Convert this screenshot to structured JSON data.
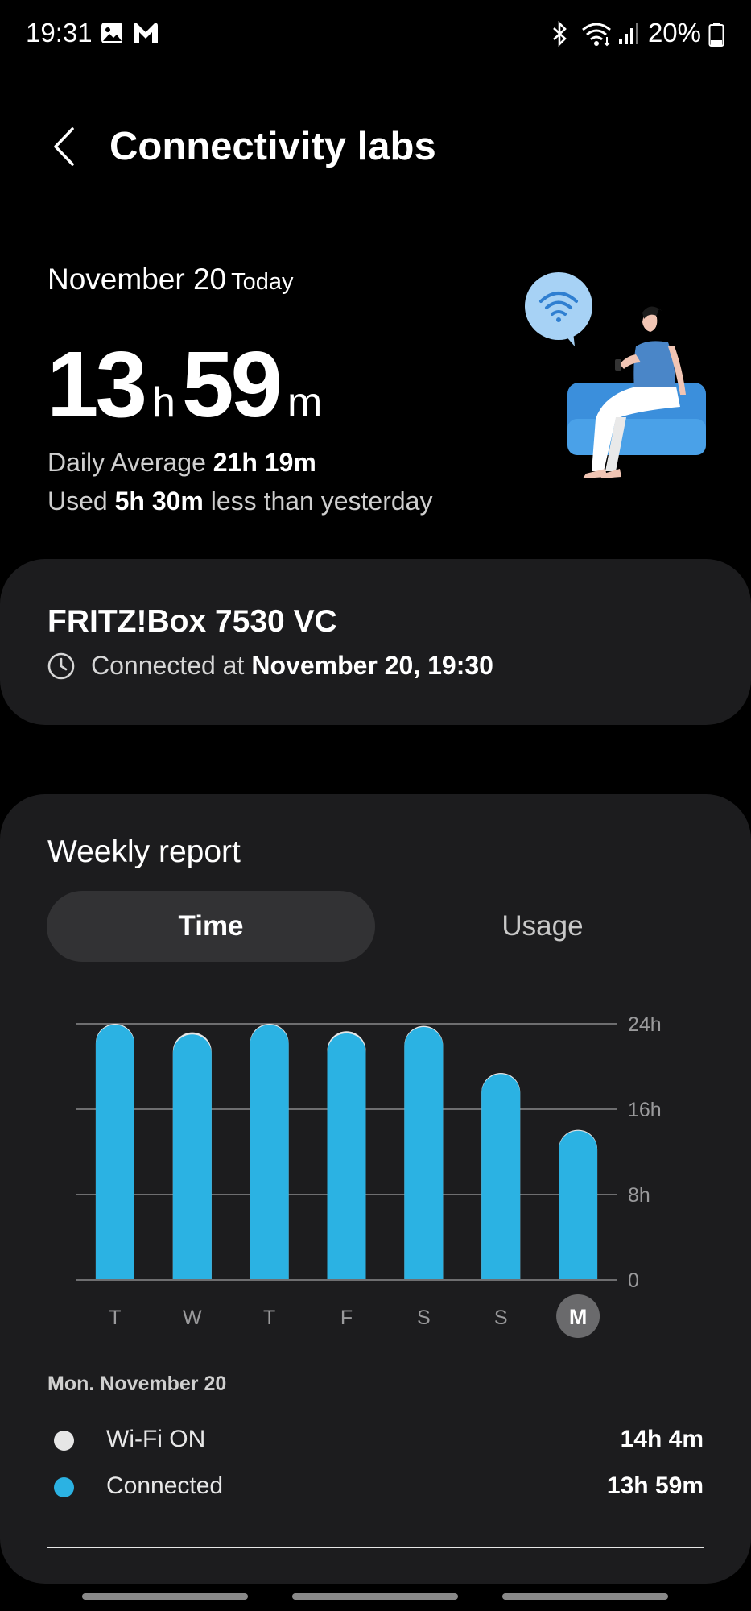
{
  "status_bar": {
    "time": "19:31",
    "battery": "20%",
    "icons": [
      "gallery-icon",
      "gmail-icon",
      "bluetooth-icon",
      "wifi-icon",
      "signal-icon",
      "battery-icon"
    ]
  },
  "header": {
    "title": "Connectivity labs",
    "back_icon": "back-arrow-icon"
  },
  "summary": {
    "date": "November 20",
    "today_label": "Today",
    "hours": "13",
    "hours_unit": "h",
    "minutes": "59",
    "minutes_unit": "m",
    "daily_average_label": "Daily Average",
    "daily_average_value": "21h 19m",
    "used_label": "Used",
    "used_value": "5h 30m",
    "used_suffix": "less than yesterday"
  },
  "network": {
    "name": "FRITZ!Box 7530 VC",
    "connected_label": "Connected at",
    "connected_value": "November 20, 19:30"
  },
  "weekly": {
    "title": "Weekly report",
    "tabs": [
      {
        "label": "Time",
        "selected": true
      },
      {
        "label": "Usage",
        "selected": false
      }
    ],
    "detail_date": "Mon. November 20",
    "legend": [
      {
        "label": "Wi-Fi ON",
        "value": "14h 4m",
        "color": "#e6e6e6"
      },
      {
        "label": "Connected",
        "value": "13h 59m",
        "color": "#2bb2e3"
      }
    ]
  },
  "chart_data": {
    "type": "bar",
    "categories": [
      "T",
      "W",
      "T",
      "F",
      "S",
      "S",
      "M"
    ],
    "selected_category_index": 6,
    "series": [
      {
        "name": "Wi-Fi ON",
        "color": "#e6e6e6",
        "values": [
          24,
          23.2,
          24,
          23.3,
          23.8,
          19.4,
          14.07
        ]
      },
      {
        "name": "Connected",
        "color": "#2bb2e3",
        "values": [
          23.9,
          23.0,
          23.9,
          23.1,
          23.7,
          19.3,
          13.98
        ]
      }
    ],
    "ytick_labels": [
      "0",
      "8h",
      "16h",
      "24h"
    ],
    "yticks": [
      0,
      8,
      16,
      24
    ],
    "ylim": [
      0,
      24
    ],
    "grid": true,
    "axis_position": "right"
  }
}
